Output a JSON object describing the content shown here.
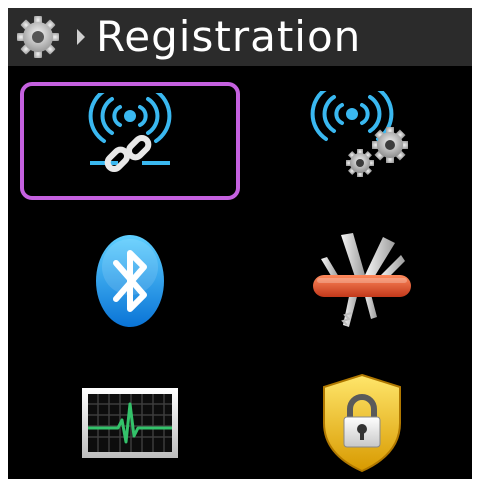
{
  "header": {
    "title": "Registration",
    "icon": "gear-icon",
    "separator_icon": "chevron-right-icon"
  },
  "menu": {
    "items": [
      {
        "id": "link",
        "icon": "wireless-link-icon",
        "selected": true
      },
      {
        "id": "link-settings",
        "icon": "wireless-settings-icon",
        "selected": false
      },
      {
        "id": "bluetooth",
        "icon": "bluetooth-icon",
        "selected": false
      },
      {
        "id": "tools",
        "icon": "swiss-army-knife-icon",
        "selected": false
      },
      {
        "id": "telemetry",
        "icon": "heartbeat-monitor-icon",
        "selected": false
      },
      {
        "id": "security",
        "icon": "padlock-shield-icon",
        "selected": false
      }
    ]
  },
  "colors": {
    "screen_bg": "#000000",
    "header_bg": "#2b2b2b",
    "title_text": "#ffffff",
    "selection_border": "#c561e0",
    "wifi_blue": "#3ab8f0"
  }
}
